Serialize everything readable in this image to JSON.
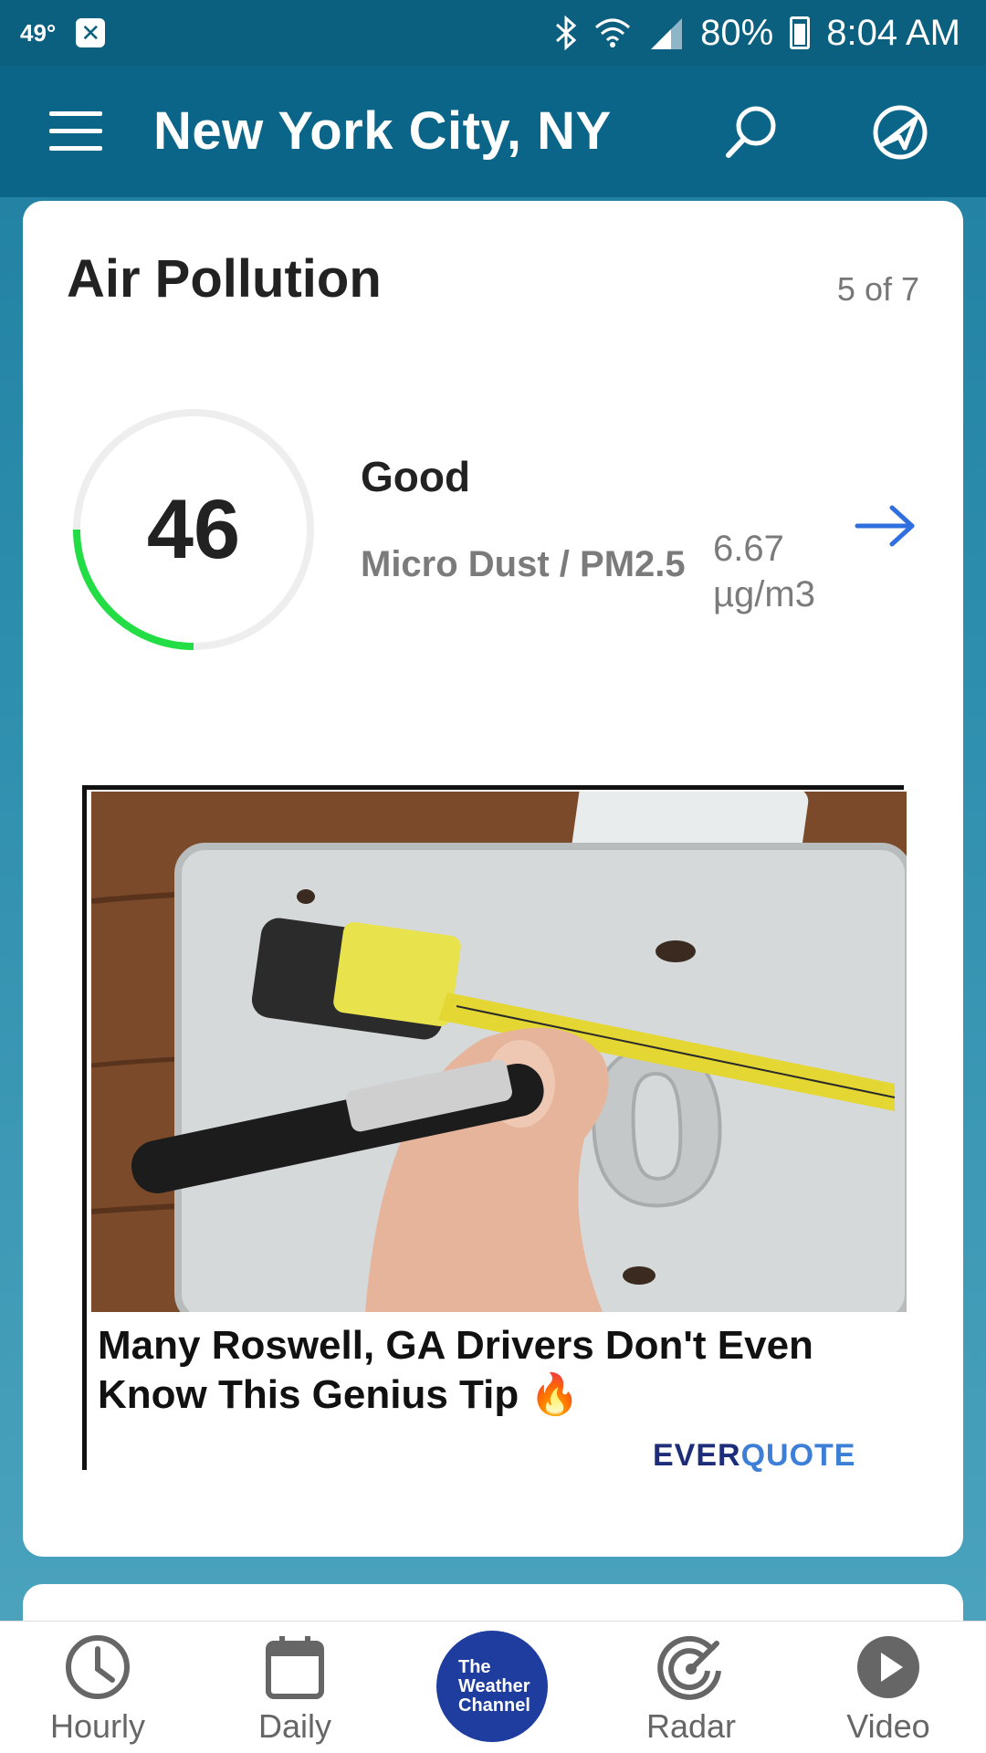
{
  "status_bar": {
    "temperature": "49°",
    "battery": "80%",
    "time": "8:04 AM",
    "icons": [
      "bluetooth-icon",
      "wifi-icon",
      "signal-icon",
      "battery-charging-icon"
    ]
  },
  "app_bar": {
    "title": "New York City, NY",
    "icons": [
      "menu-icon",
      "search-icon",
      "location-icon"
    ]
  },
  "card": {
    "title": "Air Pollution",
    "counter": "5 of 7",
    "aqi_value": "46",
    "aqi_fraction": 0.25,
    "quality": "Good",
    "pollutant": "Micro Dust / PM2.5",
    "pollutant_value_line1": "6.67",
    "pollutant_value_line2": "µg/m3",
    "colors": {
      "gauge_active": "#22dd44",
      "gauge_track": "#eeeeee",
      "arrow": "#2f6fe0"
    }
  },
  "ad": {
    "headline": "Many Roswell, GA Drivers Don't Even Know This Genius Tip 🔥",
    "brand_part1": "EVER",
    "brand_part2": "QUOTE"
  },
  "bottom_nav": {
    "items": [
      {
        "label": "Hourly",
        "icon": "clock-icon"
      },
      {
        "label": "Daily",
        "icon": "calendar-icon"
      },
      {
        "label": "",
        "icon": "the-weather-channel-logo"
      },
      {
        "label": "Radar",
        "icon": "radar-icon"
      },
      {
        "label": "Video",
        "icon": "play-icon"
      }
    ],
    "logo_lines": [
      "The",
      "Weather",
      "Channel"
    ]
  }
}
